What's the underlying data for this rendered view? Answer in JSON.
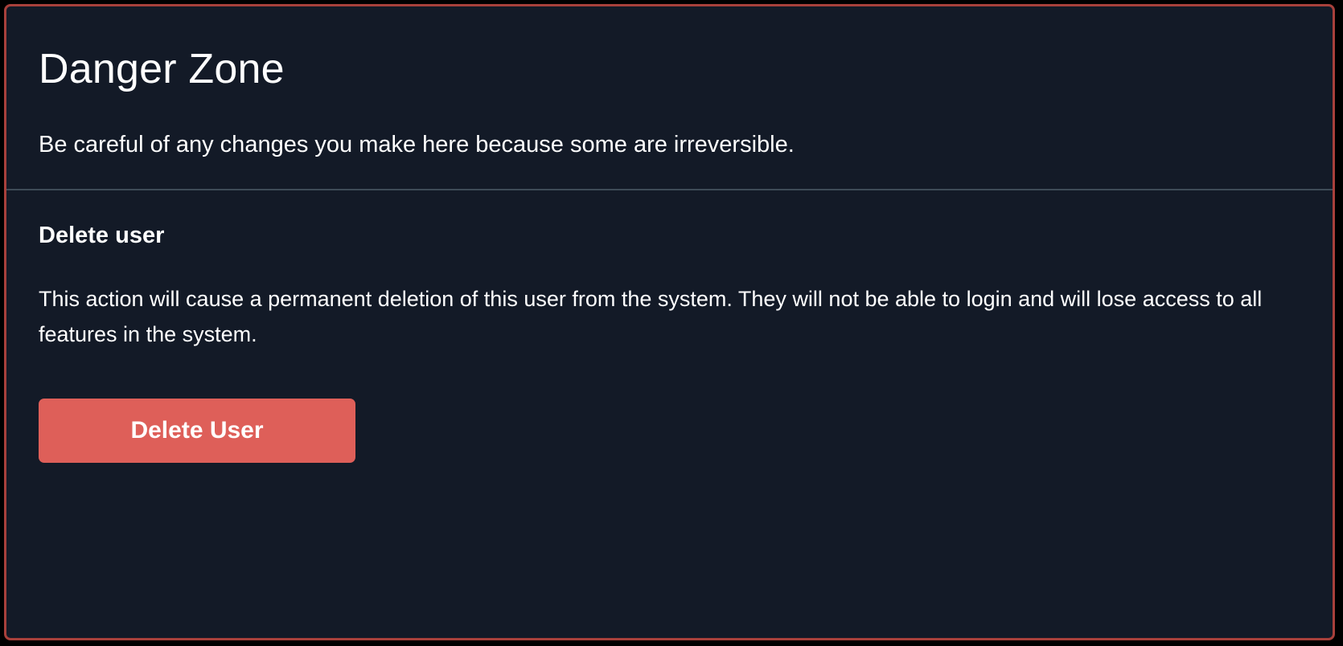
{
  "danger_zone": {
    "title": "Danger Zone",
    "subtitle": "Be careful of any changes you make here because some are irreversible."
  },
  "delete_user_section": {
    "title": "Delete user",
    "description": "This action will cause a permanent deletion of this user from the system. They will not be able to login and will lose access to all features in the system.",
    "button_label": "Delete User"
  },
  "colors": {
    "background": "#131a27",
    "border": "#a8403b",
    "danger_button": "#de5f59",
    "divider": "#3e4b57",
    "text": "#ffffff"
  }
}
